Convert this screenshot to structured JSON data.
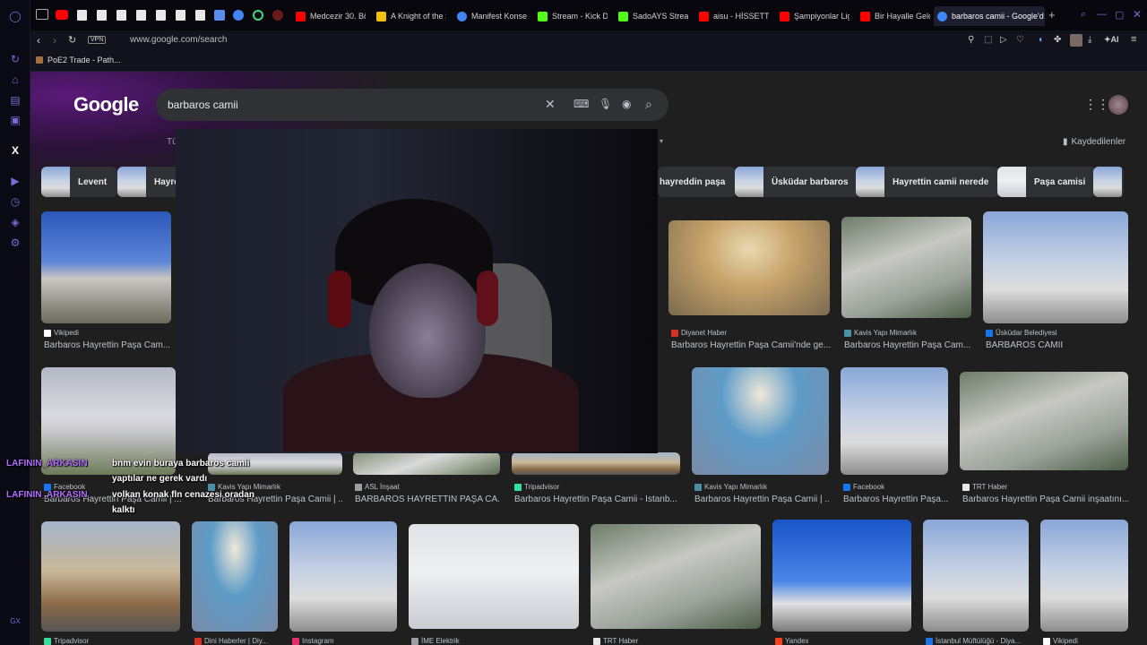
{
  "browser": {
    "tabs": [
      {
        "label": "Medcezir 30. Bö",
        "color": "#ff0000"
      },
      {
        "label": "A Knight of the S",
        "color": "#f4c20d"
      },
      {
        "label": "Manifest Konser",
        "color": "#4285f4"
      },
      {
        "label": "Stream - Kick D",
        "color": "#53fc18"
      },
      {
        "label": "SadoAYS Strea",
        "color": "#53fc18"
      },
      {
        "label": "aisu - HİSSETTİ",
        "color": "#ff0000"
      },
      {
        "label": "Şampiyonlar Lig",
        "color": "#ff0000"
      },
      {
        "label": "Bir Hayalle Gelo",
        "color": "#ff0000"
      },
      {
        "label": "barbaros camii - Google'd",
        "color": "#4285f4"
      }
    ],
    "new_tab": "+",
    "url": "www.google.com/search",
    "vpn_badge": "VPN",
    "ai_label": "AI",
    "bookmark": "PoE2 Trade - Path...",
    "gx_label": "GX"
  },
  "google": {
    "logo": "Google",
    "query": "barbaros camii",
    "tab_partial": "Tü",
    "saved_label": "Kaydedilenler",
    "chips": [
      "Levent",
      "Hayre",
      "hayreddin paşa",
      "Üsküdar barbaros",
      "Hayrettin camii nerede",
      "Paşa camisi"
    ],
    "results_row1": [
      {
        "source": "Vikipedi",
        "title": "Barbaros Hayrettin Paşa Cam...",
        "fav": "#ffffff"
      },
      {
        "source": "Diyanet Haber",
        "title": "Barbaros Hayrettin Paşa Camii'nde ge...",
        "fav": "#d93025"
      },
      {
        "source": "Kavis Yapı Mimarlık",
        "title": "Barbaros Hayrettin Paşa Cam...",
        "fav": "#4a90a4"
      },
      {
        "source": "Üsküdar Belediyesi",
        "title": "BARBAROS CAMİİ",
        "fav": "#1a73e8"
      }
    ],
    "results_row2": [
      {
        "source": "Facebook",
        "title": "Barbaros Hayrettin Paşa Camii | ...",
        "fav": "#1877f2"
      },
      {
        "source": "Kavis Yapı Mimarlık",
        "title": "Barbaros Hayrettin Paşa Camii | ...",
        "fav": "#4a90a4"
      },
      {
        "source": "ASL İnşaat",
        "title": "BARBAROS HAYRETTİN PAŞA CA...",
        "fav": "#9aa0a6"
      },
      {
        "source": "Tripadvisor",
        "title": "Barbaros Hayrettin Paşa Camii - İstanb...",
        "fav": "#34e0a1"
      },
      {
        "source": "Kavis Yapı Mimarlık",
        "title": "Barbaros Hayrettin Paşa Camii | ...",
        "fav": "#4a90a4"
      },
      {
        "source": "Facebook",
        "title": "Barbaros Hayrettin Paşa...",
        "fav": "#1877f2"
      },
      {
        "source": "TRT Haber",
        "title": "Barbaros Hayrettin Paşa Camii inşaatını...",
        "fav": "#e8e8e8"
      }
    ],
    "results_row3": [
      {
        "source": "Tripadvisor",
        "fav": "#34e0a1"
      },
      {
        "source": "Dini Haberler | Diy...",
        "fav": "#d93025"
      },
      {
        "source": "Instagram",
        "fav": "#e1306c"
      },
      {
        "source": "İME Elektrik",
        "fav": "#9aa0a6"
      },
      {
        "source": "TRT Haber",
        "fav": "#e8e8e8"
      },
      {
        "source": "Yandex",
        "fav": "#fc3f1d"
      },
      {
        "source": "İstanbul Müftülüğü - Diya...",
        "fav": "#1a73e8"
      },
      {
        "source": "Vikipedi",
        "fav": "#ffffff"
      }
    ]
  },
  "chat": [
    {
      "name": "LAFININ_ARKASIN",
      "message": "bnm evin buraya barbaros camii"
    },
    {
      "name": "",
      "message": "yaptılar ne gerek vardı"
    },
    {
      "name": "LAFININ_ARKASIN",
      "message": "volkan konak fln cenazesi oradan"
    },
    {
      "name": "",
      "message": "kalktı"
    }
  ],
  "colors": {
    "accent": "#b36cff",
    "gx_purple": "#7a6ad8",
    "search_bg": "#303134",
    "page_bg": "#1f1f1f"
  }
}
